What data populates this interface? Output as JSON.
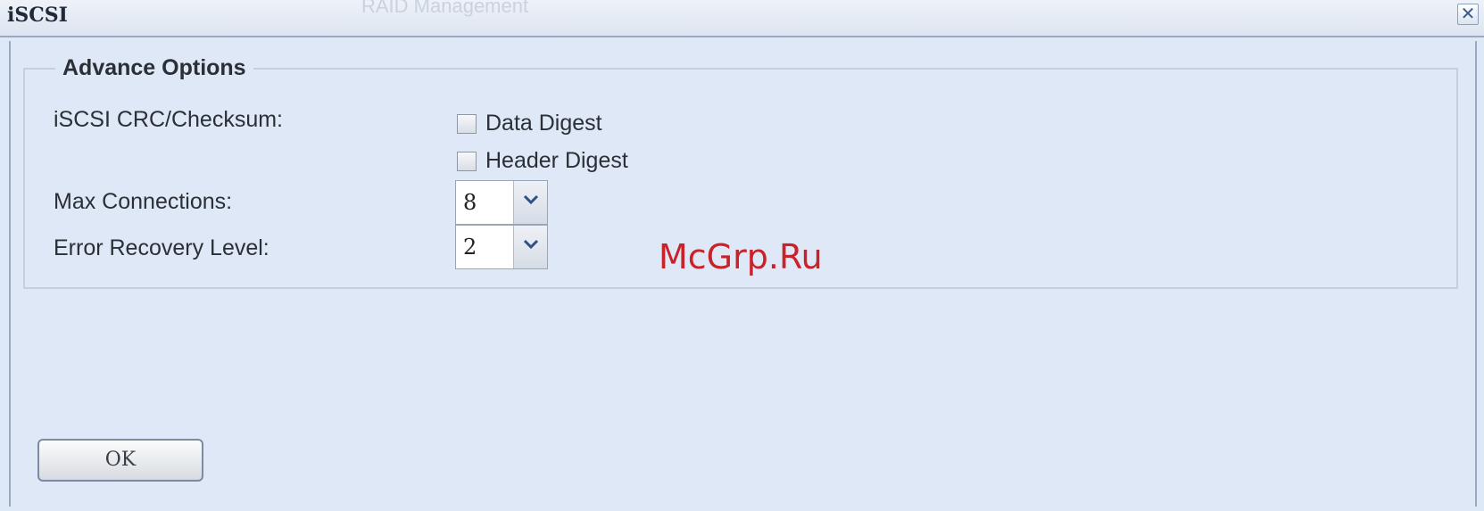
{
  "window": {
    "title": "iSCSI",
    "background_tab_text": "RAID Management",
    "close_label": "✕"
  },
  "advance_options": {
    "legend": "Advance Options",
    "crc_label": "iSCSI CRC/Checksum:",
    "data_digest_label": "Data Digest",
    "data_digest_checked": false,
    "header_digest_label": "Header Digest",
    "header_digest_checked": false,
    "max_connections_label": "Max Connections:",
    "max_connections_value": "8",
    "error_recovery_label": "Error Recovery Level:",
    "error_recovery_value": "2"
  },
  "watermark": "McGrp.Ru",
  "footer": {
    "ok_label": "OK"
  },
  "icons": {
    "close": "close-icon",
    "dropdown": "chevron-down-icon"
  },
  "colors": {
    "panel_background": "#dfe8f6",
    "watermark": "#c8222a"
  }
}
